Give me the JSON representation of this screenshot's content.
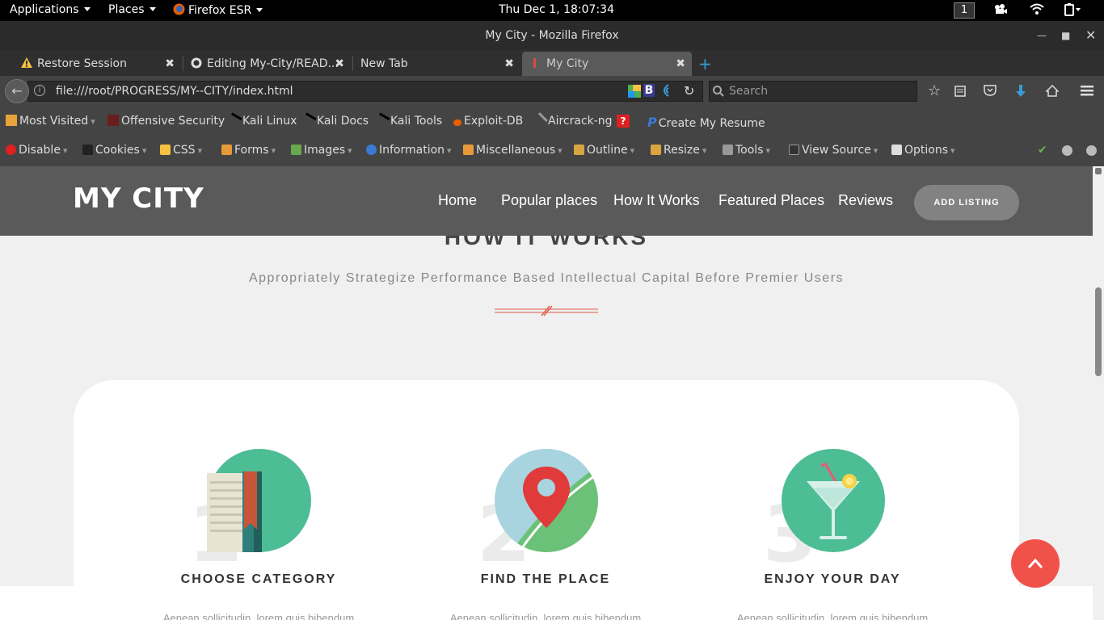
{
  "topbar": {
    "applications": "Applications",
    "places": "Places",
    "browser_menu": "Firefox ESR",
    "clock": "Thu Dec  1, 18:07:34",
    "workspace": "1"
  },
  "window": {
    "title": "My City - Mozilla Firefox"
  },
  "tabs": [
    {
      "label": "Restore Session"
    },
    {
      "label": "Editing My-City/READ..."
    },
    {
      "label": "New Tab"
    },
    {
      "label": "My City"
    }
  ],
  "navbar": {
    "url": "file:///root/PROGRESS/MY--CITY/index.html",
    "search_placeholder": "Search"
  },
  "bookmarks": [
    {
      "label": "Most Visited",
      "has_dropdown": true
    },
    {
      "label": "Offensive Security"
    },
    {
      "label": "Kali Linux"
    },
    {
      "label": "Kali Docs"
    },
    {
      "label": "Kali Tools"
    },
    {
      "label": "Exploit-DB"
    },
    {
      "label": "Aircrack-ng"
    },
    {
      "label": "Create My Resume"
    }
  ],
  "webdev": [
    {
      "label": "Disable"
    },
    {
      "label": "Cookies"
    },
    {
      "label": "CSS"
    },
    {
      "label": "Forms"
    },
    {
      "label": "Images"
    },
    {
      "label": "Information"
    },
    {
      "label": "Miscellaneous"
    },
    {
      "label": "Outline"
    },
    {
      "label": "Resize"
    },
    {
      "label": "Tools"
    },
    {
      "label": "View Source"
    },
    {
      "label": "Options"
    }
  ],
  "site": {
    "logo": "MY CITY",
    "menu": [
      "Home",
      "Popular places",
      "How It Works",
      "Featured Places",
      "Reviews"
    ],
    "cta": "ADD LISTING"
  },
  "section": {
    "title": "HOW IT WORKS",
    "subtitle": "Appropriately Strategize Performance Based Intellectual Capital Before Premier Users"
  },
  "steps": [
    {
      "number": "1",
      "title": "CHOOSE CATEGORY",
      "text": "Aenean sollicitudin, lorem quis bibendum",
      "icon": "book-icon"
    },
    {
      "number": "2",
      "title": "FIND THE PLACE",
      "text": "Aenean sollicitudin, lorem quis bibendum",
      "icon": "map-pin-icon"
    },
    {
      "number": "3",
      "title": "ENJOY YOUR DAY",
      "text": "Aenean sollicitudin, lorem quis bibendum",
      "icon": "cocktail-icon"
    }
  ],
  "colors": {
    "header_bg": "#5a5a5a",
    "accent_red": "#f0524a",
    "icon_green": "#4dbd95"
  }
}
